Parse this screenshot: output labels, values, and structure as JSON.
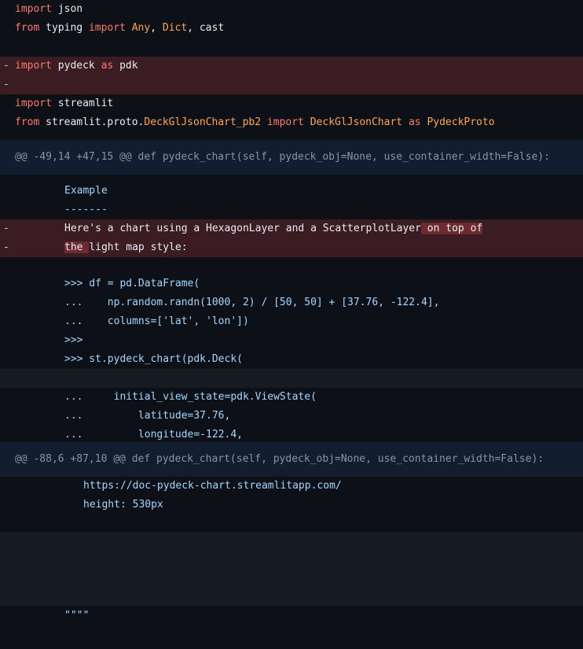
{
  "colors": {
    "background": "#0d1117",
    "deleted_bg": "#3b1c22",
    "deleted_word_bg": "#6e2b2f",
    "hunk_bg": "#121d2f",
    "keyword": "#ff7b72",
    "type": "#ffa657",
    "docstring": "#a5d6ff"
  },
  "l1": {
    "kw": "import",
    "rest": " json"
  },
  "l2": {
    "kw1": "from",
    "mod": " typing ",
    "kw2": "import",
    "t1": "Any",
    "sep1": ", ",
    "t2": "Dict",
    "sep2": ", cast"
  },
  "l3": {
    "sign": "-",
    "kw1": "import",
    "mod": " pydeck ",
    "kw2": "as",
    "rest": " pdk"
  },
  "l4": {
    "sign": "-"
  },
  "l5": {
    "kw": "import",
    "rest": " streamlit"
  },
  "l6": {
    "kw1": "from",
    "mod1": " streamlit.proto.",
    "t1": "DeckGlJsonChart_pb2",
    "sp": " ",
    "kw2": "import",
    "sp2": " ",
    "t2": "DeckGlJsonChart",
    "sp3": " ",
    "kw3": "as",
    "sp4": " ",
    "t3": "PydeckProto"
  },
  "hunk1": "@@ -49,14 +47,15 @@ def pydeck_chart(self, pydeck_obj=None, use_container_width=False):",
  "d1": "Example",
  "d2": "-------",
  "d3": {
    "sign": "-",
    "text": "Here's a chart using a HexagonLayer and a ScatterplotLayer",
    "hl": " on top of"
  },
  "d4": {
    "sign": "-",
    "hl": "the ",
    "text": "light map style:"
  },
  "d5": ">>> df = pd.DataFrame(",
  "d6": "...    np.random.randn(1000, 2) / [50, 50] + [37.76, -122.4],",
  "d7": "...    columns=['lat', 'lon'])",
  "d8": ">>>",
  "d9": ">>> st.pydeck_chart(pdk.Deck(",
  "d10": "...     initial_view_state=pdk.ViewState(",
  "d11": "...         latitude=37.76,",
  "d12": "...         longitude=-122.4,",
  "hunk2": "@@ -88,6 +87,10 @@ def pydeck_chart(self, pydeck_obj=None, use_container_width=False):",
  "e1": "https://doc-pydeck-chart.streamlitapp.com/",
  "e2": "height: 530px",
  "e3": "\"\"\"\""
}
